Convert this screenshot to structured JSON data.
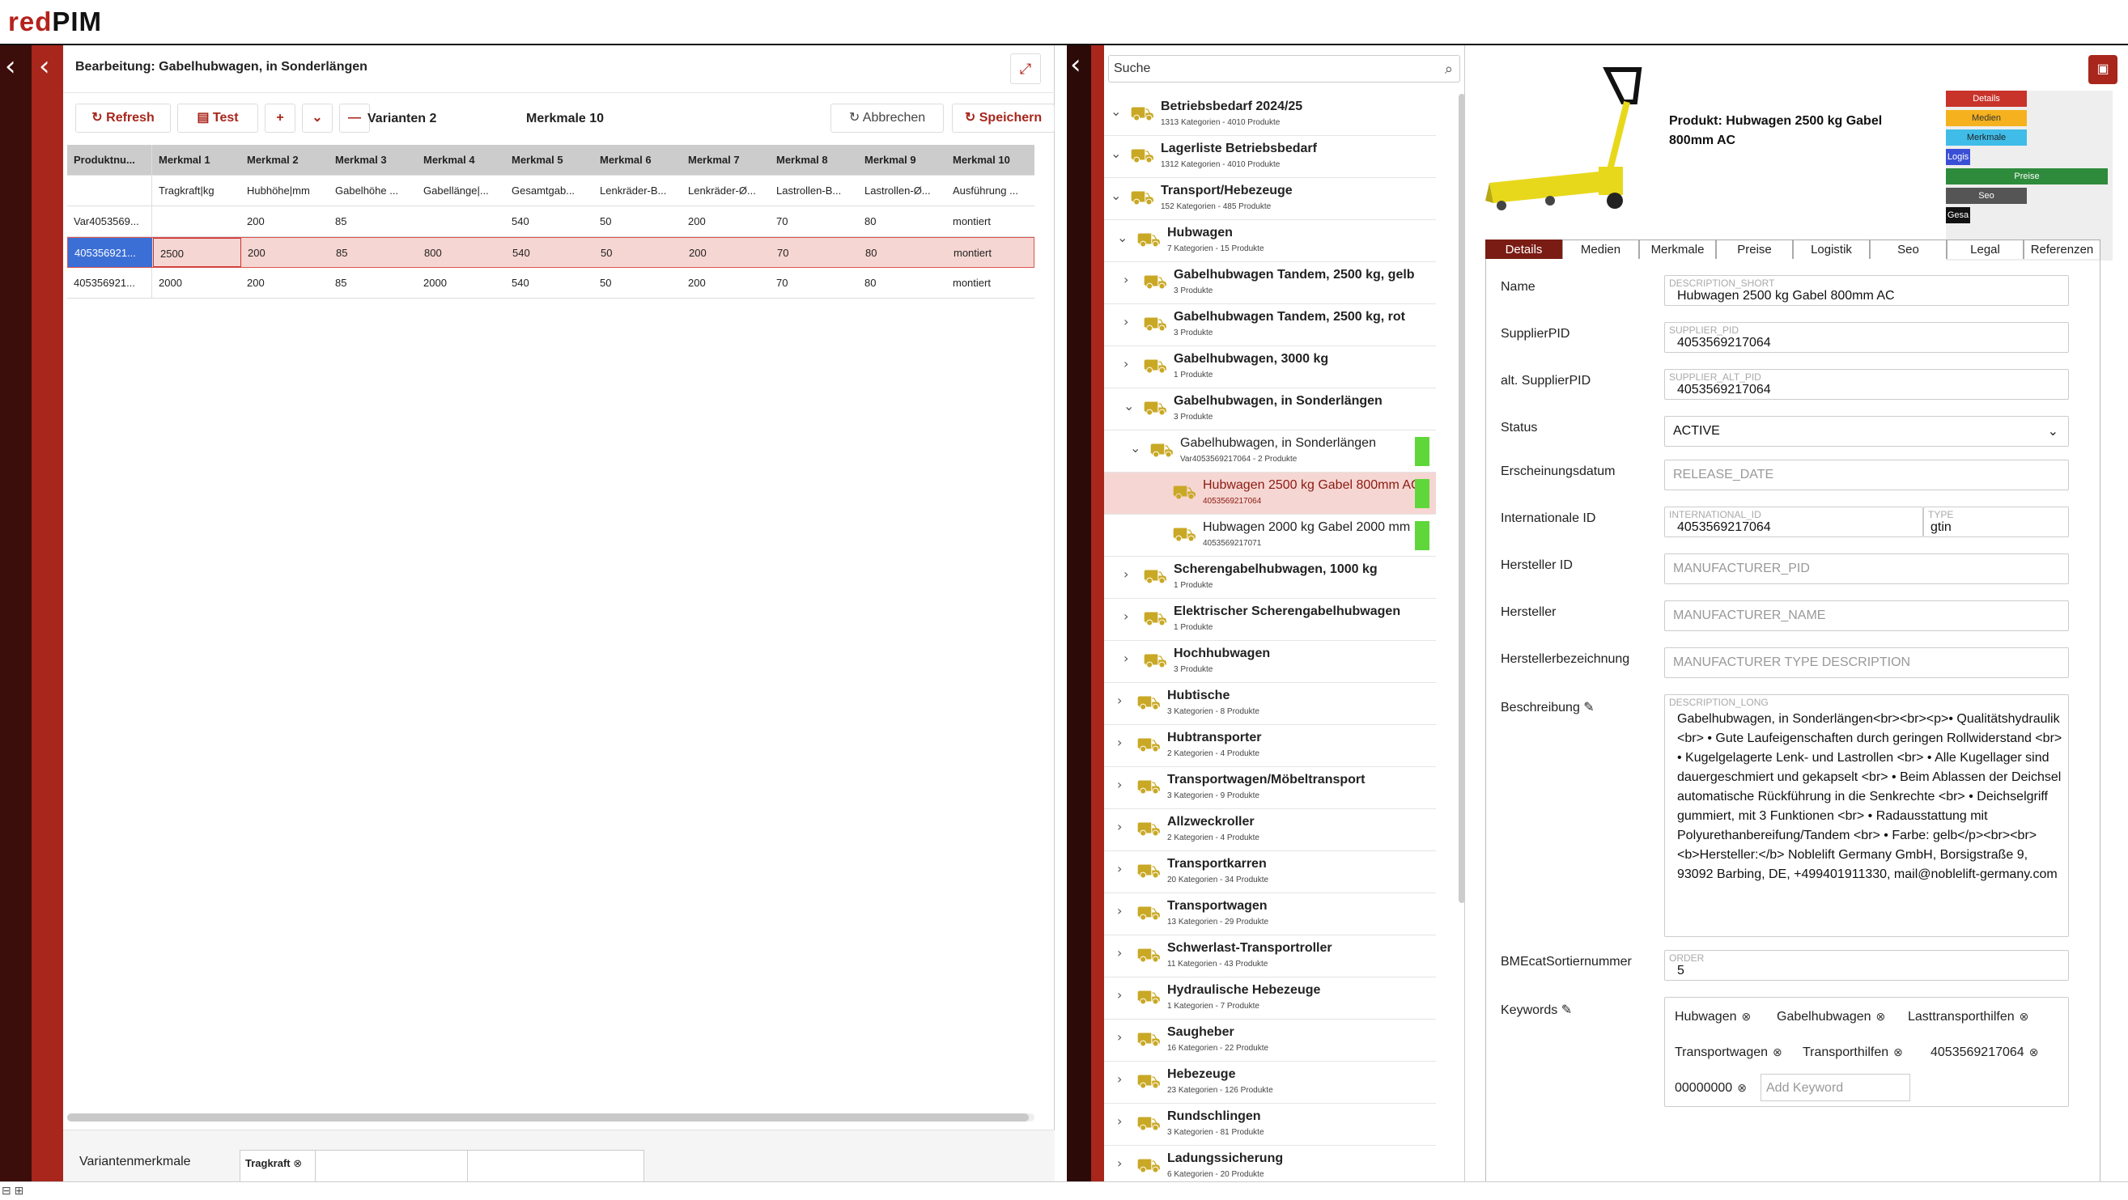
{
  "app": {
    "logo_red": "red",
    "logo_dark": "PIM"
  },
  "editor": {
    "title": "Bearbeitung: Gabelhubwagen, in Sonderlängen",
    "buttons": {
      "refresh": "Refresh",
      "test": "Test",
      "plus": "+",
      "expand_down": "⌄",
      "minus": "—",
      "cancel": "Abbrechen",
      "save": "Speichern"
    },
    "variants_label": "Varianten 2",
    "features_label": "Merkmale 10",
    "columns": [
      "Produktnu...",
      "Merkmal 1",
      "Merkmal 2",
      "Merkmal 3",
      "Merkmal 4",
      "Merkmal 5",
      "Merkmal 6",
      "Merkmal 7",
      "Merkmal 8",
      "Merkmal 9",
      "Merkmal 10"
    ],
    "units_row": [
      "",
      "Tragkraft|kg",
      "Hubhöhe|mm",
      "Gabelhöhe ...",
      "Gabellänge|...",
      "Gesamtgab...",
      "Lenkräder-B...",
      "Lenkräder-Ø...",
      "Lastrollen-B...",
      "Lastrollen-Ø...",
      "Ausführung ..."
    ],
    "rows": [
      [
        "Var4053569...",
        "",
        "200",
        "85",
        "",
        "540",
        "50",
        "200",
        "70",
        "80",
        "montiert"
      ],
      [
        "405356921...",
        "2500",
        "200",
        "85",
        "800",
        "540",
        "50",
        "200",
        "70",
        "80",
        "montiert"
      ],
      [
        "405356921...",
        "2000",
        "200",
        "85",
        "2000",
        "540",
        "50",
        "200",
        "70",
        "80",
        "montiert"
      ]
    ],
    "variant_features_label": "Variantenmerkmale",
    "variant_chip": "Tragkraft"
  },
  "tree": {
    "search_placeholder": "Suche",
    "nodes": [
      {
        "name": "Betriebsbedarf 2024/25",
        "sub": "1313 Kategorien - 4010 Produkte",
        "bold": true
      },
      {
        "name": "Lagerliste Betriebsbedarf",
        "sub": "1312 Kategorien - 4010 Produkte",
        "bold": true
      },
      {
        "name": "Transport/Hebezeuge",
        "sub": "152 Kategorien - 485 Produkte",
        "bold": true
      },
      {
        "name": "Hubwagen",
        "sub": "7 Kategorien - 15 Produkte",
        "bold": true
      },
      {
        "name": "Gabelhubwagen Tandem, 2500 kg, gelb",
        "sub": "3 Produkte",
        "bold": true
      },
      {
        "name": "Gabelhubwagen Tandem, 2500 kg, rot",
        "sub": "3 Produkte",
        "bold": true
      },
      {
        "name": "Gabelhubwagen, 3000 kg",
        "sub": "1 Produkte",
        "bold": true
      },
      {
        "name": "Gabelhubwagen, in Sonderlängen",
        "sub": "3 Produkte",
        "bold": true
      },
      {
        "name": "Gabelhubwagen, in Sonderlängen",
        "sub": "Var4053569217064 - 2 Produkte",
        "bold": false
      },
      {
        "name": "Hubwagen 2500 kg Gabel 800mm AC",
        "sub": "4053569217064",
        "bold": false
      },
      {
        "name": "Hubwagen 2000 kg Gabel 2000 mm",
        "sub": "4053569217071",
        "bold": false
      },
      {
        "name": "Scherengabelhubwagen, 1000 kg",
        "sub": "1 Produkte",
        "bold": true
      },
      {
        "name": "Elektrischer Scherengabelhubwagen",
        "sub": "1 Produkte",
        "bold": true
      },
      {
        "name": "Hochhubwagen",
        "sub": "3 Produkte",
        "bold": true
      },
      {
        "name": "Hubtische",
        "sub": "3 Kategorien - 8 Produkte",
        "bold": true
      },
      {
        "name": "Hubtransporter",
        "sub": "2 Kategorien - 4 Produkte",
        "bold": true
      },
      {
        "name": "Transportwagen/Möbeltransport",
        "sub": "3 Kategorien - 9 Produkte",
        "bold": true
      },
      {
        "name": "Allzweckroller",
        "sub": "2 Kategorien - 4 Produkte",
        "bold": true
      },
      {
        "name": "Transportkarren",
        "sub": "20 Kategorien - 34 Produkte",
        "bold": true
      },
      {
        "name": "Transportwagen",
        "sub": "13 Kategorien - 29 Produkte",
        "bold": true
      },
      {
        "name": "Schwerlast-Transportroller",
        "sub": "11 Kategorien - 43 Produkte",
        "bold": true
      },
      {
        "name": "Hydraulische Hebezeuge",
        "sub": "1 Kategorien - 7 Produkte",
        "bold": true
      },
      {
        "name": "Saugheber",
        "sub": "16 Kategorien - 22 Produkte",
        "bold": true
      },
      {
        "name": "Hebezeuge",
        "sub": "23 Kategorien - 126 Produkte",
        "bold": true
      },
      {
        "name": "Rundschlingen",
        "sub": "3 Kategorien - 81 Produkte",
        "bold": true
      },
      {
        "name": "Ladungssicherung",
        "sub": "6 Kategorien - 20 Produkte",
        "bold": true
      }
    ]
  },
  "product": {
    "title": "Produkt: Hubwagen 2500 kg Gabel 800mm AC",
    "mini_nav": [
      "Details",
      "Medien",
      "Merkmale",
      "Logis",
      "Preise",
      "Seo",
      "Gesa"
    ],
    "tabs": [
      "Details",
      "Medien",
      "Merkmale",
      "Preise",
      "Logistik",
      "Seo",
      "Legal",
      "Referenzen"
    ],
    "fields": {
      "name_label": "Name",
      "name_tag": "DESCRIPTION_SHORT",
      "name_value": "Hubwagen 2500 kg Gabel 800mm AC",
      "supplier_label": "SupplierPID",
      "supplier_tag": "SUPPLIER_PID",
      "supplier_value": "4053569217064",
      "alt_label": "alt. SupplierPID",
      "alt_tag": "SUPPLIER_ALT_PID",
      "alt_value": "4053569217064",
      "status_label": "Status",
      "status_value": "ACTIVE",
      "release_label": "Erscheinungsdatum",
      "release_placeholder": "RELEASE_DATE",
      "intl_label": "Internationale ID",
      "intl_tag": "INTERNATIONAL_ID",
      "intl_value": "4053569217064",
      "type_tag": "TYPE",
      "type_value": "gtin",
      "mfr_id_label": "Hersteller ID",
      "mfr_id_placeholder": "MANUFACTURER_PID",
      "mfr_label": "Hersteller",
      "mfr_placeholder": "MANUFACTURER_NAME",
      "mfr_desc_label": "Herstellerbezeichnung",
      "mfr_desc_placeholder": "MANUFACTURER TYPE DESCRIPTION",
      "desc_label": "Beschreibung",
      "desc_tag": "DESCRIPTION_LONG",
      "desc_value": "Gabelhubwagen, in Sonderlängen<br><br><p>• Qualitätshydraulik <br> •      Gute Laufeigenschaften durch geringen Rollwiderstand <br> •      Kugelgelagerte Lenk- und Lastrollen <br> •      Alle Kugellager sind dauergeschmiert und gekapselt <br> •      Beim Ablassen der Deichsel automatische Rückführung in die Senkrechte <br> •      Deichselgriff gummiert, mit 3 Funktionen <br> •      Radausstattung mit Polyurethanbereifung/Tandem <br> •      Farbe: gelb</p><br><br><b>Hersteller:</b> Noblelift Germany GmbH, Borsigstraße 9, 93092 Barbing, DE, +499401911330,  mail@noblelift-germany.com",
      "order_label": "BMEcatSortiernummer",
      "order_tag": "ORDER",
      "order_value": "5",
      "keywords_label": "Keywords",
      "keywords": [
        "Hubwagen",
        "Gabelhubwagen",
        "Lasttransporthilfen",
        "Transportwagen",
        "Transporthilfen",
        "4053569217064",
        "00000000"
      ],
      "add_keyword_placeholder": "Add Keyword"
    }
  },
  "colors": {
    "brand": "#a8261c",
    "dark": "#3b0d0b",
    "selection": "#f6d6d2",
    "grid_selected_cell": "#3b6fd6",
    "green": "#5fd73a"
  }
}
